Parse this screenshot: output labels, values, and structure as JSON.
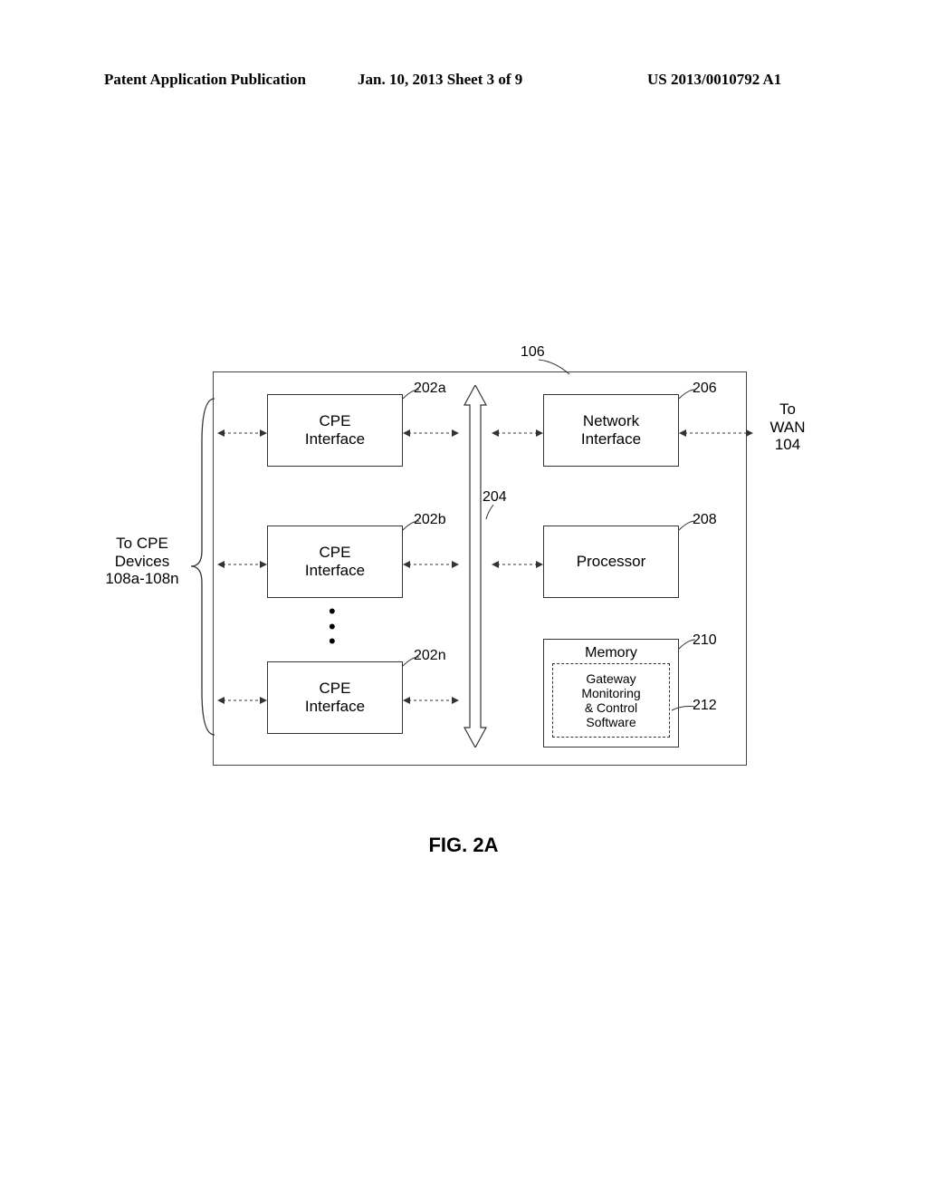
{
  "header": {
    "left": "Patent Application Publication",
    "mid": "Jan. 10, 2013  Sheet 3 of 9",
    "right": "US 2013/0010792 A1"
  },
  "figure_caption": "FIG. 2A",
  "blocks": {
    "cpe_a": "CPE\nInterface",
    "cpe_b": "CPE\nInterface",
    "cpe_n": "CPE\nInterface",
    "net_if": "Network\nInterface",
    "processor": "Processor",
    "memory": "Memory",
    "software": "Gateway\nMonitoring\n& Control\nSoftware"
  },
  "side_labels": {
    "left": "To CPE\nDevices\n108a-108n",
    "right": "To\nWAN\n104"
  },
  "refs": {
    "outer": "106",
    "cpe_a": "202a",
    "cpe_b": "202b",
    "cpe_n": "202n",
    "bus": "204",
    "net_if": "206",
    "processor": "208",
    "memory": "210",
    "software": "212"
  }
}
